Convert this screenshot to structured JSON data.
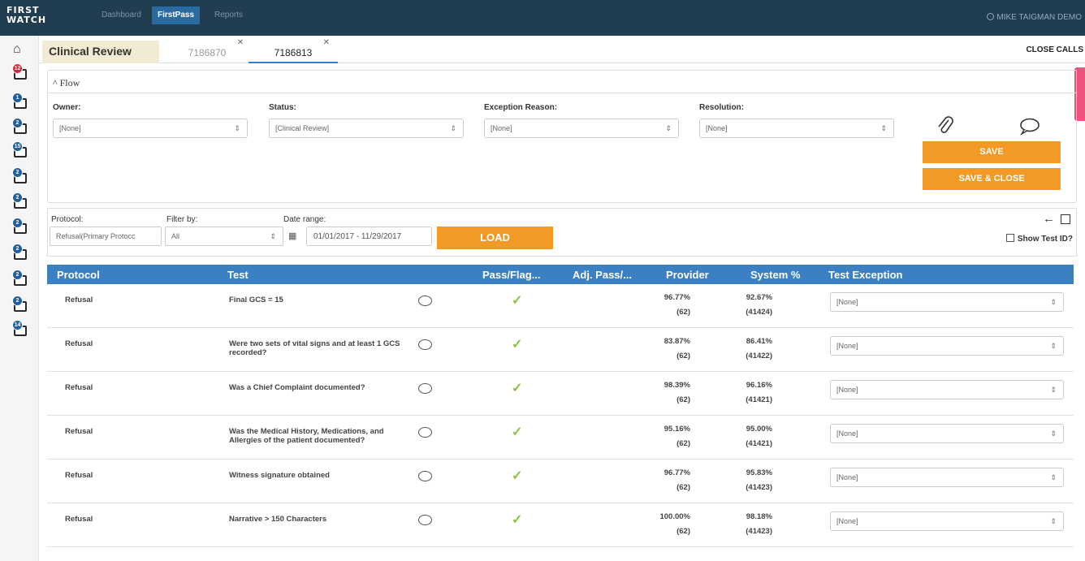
{
  "app": {
    "logo": "FIRST WATCH",
    "nav": [
      "Dashboard",
      "FirstPass",
      "Reports"
    ],
    "user": "MIKE TAIGMAN DEMO"
  },
  "sidebar": {
    "badges": [
      "12",
      "1",
      "2",
      "15",
      "2",
      "2",
      "2",
      "2",
      "2",
      "2",
      "14"
    ]
  },
  "tabs": {
    "active_section": "Clinical Review",
    "records": [
      "7186870",
      "7186813"
    ],
    "close_label": "CLOSE CALLS"
  },
  "flow": {
    "header": "^ Flow",
    "owner": {
      "label": "Owner:",
      "value": "[None]"
    },
    "status": {
      "label": "Status:",
      "value": "[Clinical Review]"
    },
    "exception": {
      "label": "Exception Reason:",
      "value": "[None]"
    },
    "resolution": {
      "label": "Resolution:",
      "value": "[None]"
    },
    "save": "SAVE",
    "save_close": "SAVE & CLOSE"
  },
  "filters": {
    "protocol": {
      "label": "Protocol:",
      "value": "Refusal(Primary Protocc"
    },
    "filter_by": {
      "label": "Filter by:",
      "value": "All"
    },
    "date_range": {
      "label": "Date range:",
      "value": "01/01/2017 - 11/29/2017"
    },
    "load": "LOAD",
    "show_test_id": "Show Test ID?"
  },
  "table": {
    "columns": [
      "Protocol",
      "Test",
      "Pass/Flag...",
      "Adj. Pass/...",
      "Provider",
      "System %",
      "Test Exception"
    ],
    "rows": [
      {
        "protocol": "Refusal",
        "test": "Final GCS = 15",
        "provider_pct": "96.77%",
        "provider_n": "(62)",
        "system_pct": "92.67%",
        "system_n": "(41424)",
        "exception": "[None]"
      },
      {
        "protocol": "Refusal",
        "test": "Were two sets of vital signs and at least 1 GCS recorded?",
        "provider_pct": "83.87%",
        "provider_n": "(62)",
        "system_pct": "86.41%",
        "system_n": "(41422)",
        "exception": "[None]"
      },
      {
        "protocol": "Refusal",
        "test": "Was a Chief Complaint documented?",
        "provider_pct": "98.39%",
        "provider_n": "(62)",
        "system_pct": "96.16%",
        "system_n": "(41421)",
        "exception": "[None]"
      },
      {
        "protocol": "Refusal",
        "test": "Was the Medical History, Medications, and Allergies of the patient documented?",
        "provider_pct": "95.16%",
        "provider_n": "(62)",
        "system_pct": "95.00%",
        "system_n": "(41421)",
        "exception": "[None]"
      },
      {
        "protocol": "Refusal",
        "test": "Witness signature obtained",
        "provider_pct": "96.77%",
        "provider_n": "(62)",
        "system_pct": "95.83%",
        "system_n": "(41423)",
        "exception": "[None]"
      },
      {
        "protocol": "Refusal",
        "test": "Narrative > 150 Characters",
        "provider_pct": "100.00%",
        "provider_n": "(62)",
        "system_pct": "98.18%",
        "system_n": "(41423)",
        "exception": "[None]"
      }
    ]
  }
}
